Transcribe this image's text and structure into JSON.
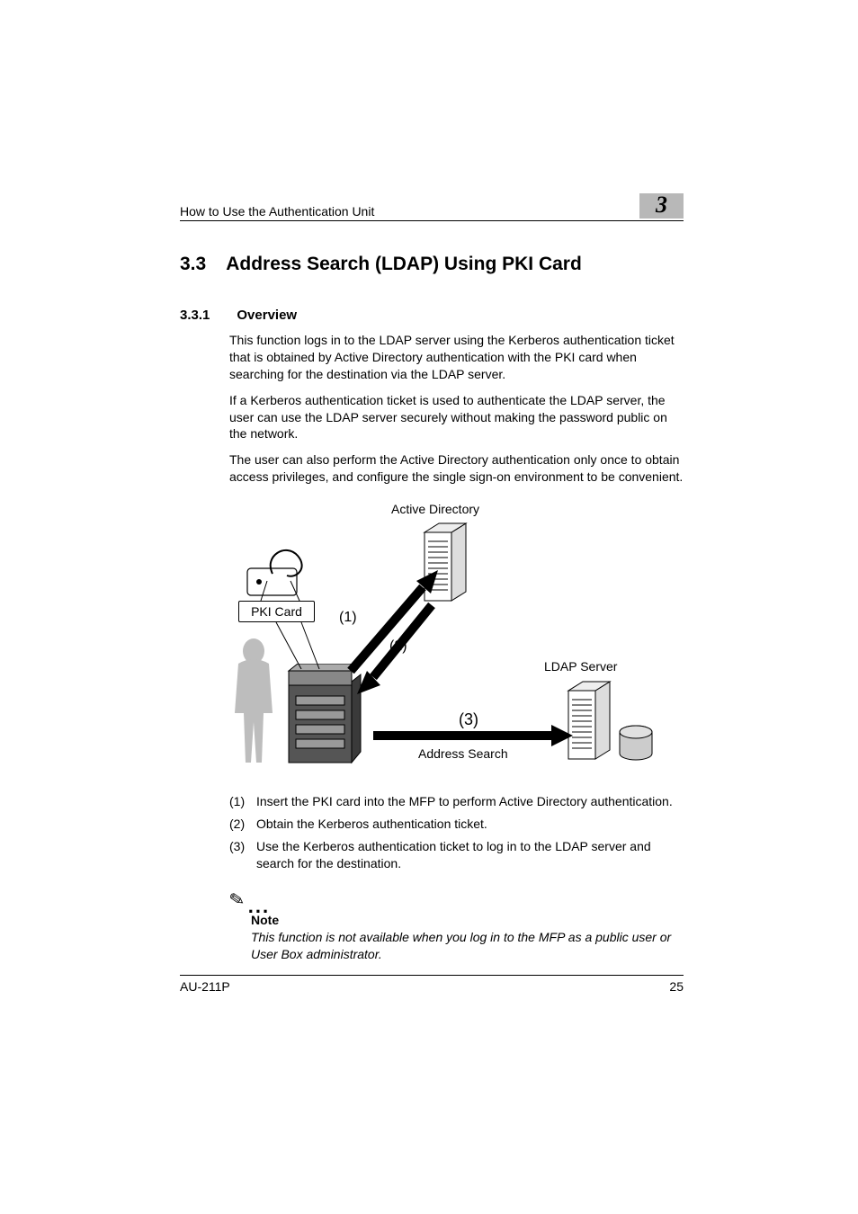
{
  "header": {
    "title": "How to Use the Authentication Unit",
    "chapter": "3"
  },
  "section": {
    "num": "3.3",
    "title": "Address Search (LDAP) Using PKI Card"
  },
  "subsection": {
    "num": "3.3.1",
    "title": "Overview"
  },
  "paragraphs": {
    "p1": "This function logs in to the LDAP server using the Kerberos authentication ticket that is obtained by Active Directory authentication with the PKI card when searching for the destination via the LDAP server.",
    "p2": "If a Kerberos authentication ticket is used to authenticate the LDAP server, the user can use the LDAP server securely without making the password public on the network.",
    "p3": "The user can also perform the Active Directory authentication only once to obtain access privileges, and configure the single sign-on environment to be convenient."
  },
  "diagram": {
    "active_directory": "Active Directory",
    "pki_card": "PKI Card",
    "ldap_server": "LDAP Server",
    "address_search": "Address Search",
    "n1": "(1)",
    "n2": "(2)",
    "n3": "(3)"
  },
  "steps": {
    "s1_num": "(1)",
    "s1": "Insert the PKI card into the MFP to perform Active Directory authentication.",
    "s2_num": "(2)",
    "s2": "Obtain the Kerberos authentication ticket.",
    "s3_num": "(3)",
    "s3": "Use the Kerberos authentication ticket to log in to the LDAP server and search for the destination."
  },
  "note": {
    "label": "Note",
    "text": "This function is not available when you log in to the MFP as a public user or User Box administrator."
  },
  "footer": {
    "model": "AU-211P",
    "page": "25"
  }
}
